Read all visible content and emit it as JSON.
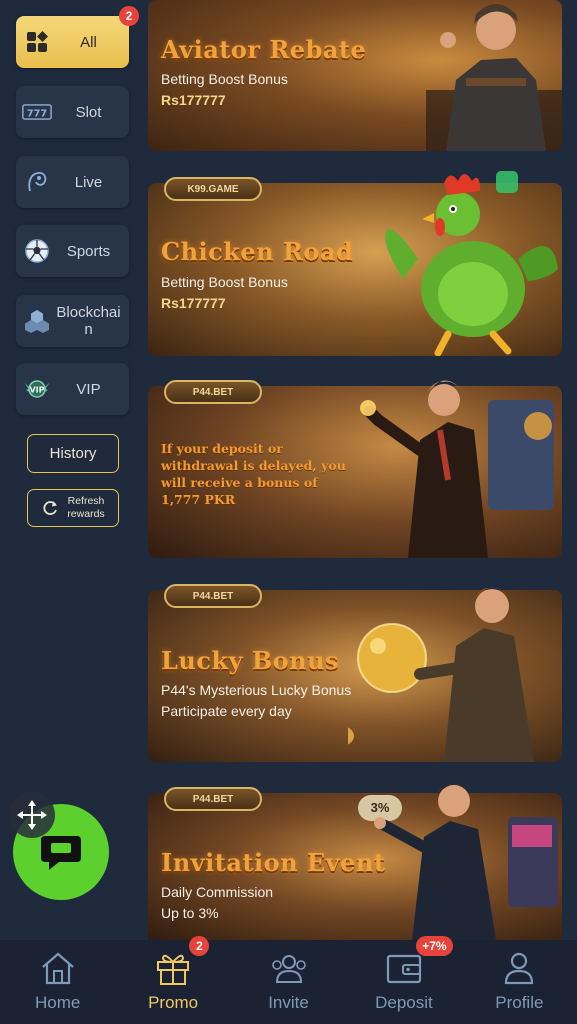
{
  "sidebar": {
    "categories": [
      {
        "label": "All",
        "icon": "grid-icon",
        "badge": "2",
        "active": true
      },
      {
        "label": "Slot",
        "icon": "slot-777-icon"
      },
      {
        "label": "Live",
        "icon": "live-dealer-icon"
      },
      {
        "label": "Sports",
        "icon": "soccer-ball-icon"
      },
      {
        "label": "Blockchai\nn",
        "icon": "blockchain-icon"
      },
      {
        "label": "VIP",
        "icon": "vip-crest-icon"
      }
    ],
    "history_label": "History",
    "refresh_label": "Refresh\nrewards"
  },
  "banners": [
    {
      "title": "Aviator Rebate",
      "subtitle": "Betting Boost Bonus",
      "amount": "Rs177777"
    },
    {
      "tag": "K99.GAME",
      "title": "Chicken Road",
      "subtitle": "Betting Boost Bonus",
      "amount": "Rs177777"
    },
    {
      "tag": "P44.BET",
      "text": "If your deposit or withdrawal is delayed, you will receive a bonus of 1,777 PKR"
    },
    {
      "tag": "P44.BET",
      "title": "Lucky Bonus",
      "subtitle": "P44's Mysterious Lucky Bonus",
      "subtitle2": "Participate every day"
    },
    {
      "tag": "P44.BET",
      "title": "Invitation Event",
      "subtitle": "Daily Commission",
      "subtitle2": "Up to 3%",
      "extra": "3%"
    }
  ],
  "bottom_nav": [
    {
      "label": "Home",
      "icon": "home-icon"
    },
    {
      "label": "Promo",
      "icon": "gift-icon",
      "badge": "2",
      "active": true
    },
    {
      "label": "Invite",
      "icon": "invite-users-icon"
    },
    {
      "label": "Deposit",
      "icon": "wallet-icon",
      "badge": "+7%"
    },
    {
      "label": "Profile",
      "icon": "profile-icon"
    }
  ],
  "colors": {
    "accent": "#f0c860",
    "background": "#1f2a3d",
    "chat": "#5cd12e",
    "badge": "#e8433a"
  }
}
